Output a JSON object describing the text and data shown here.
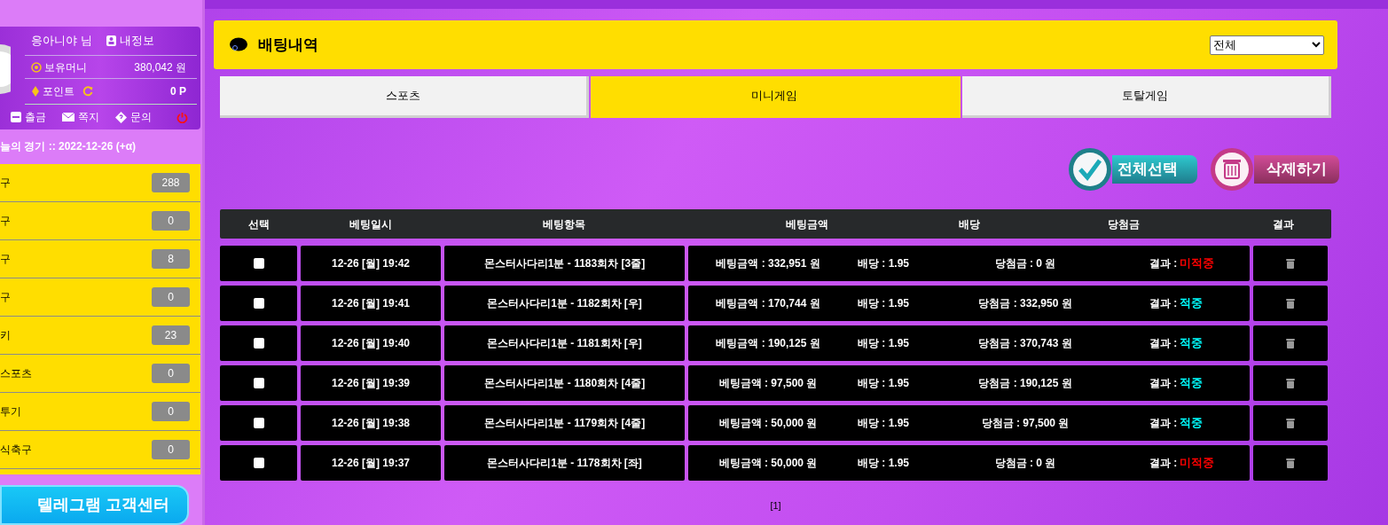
{
  "user": {
    "name": "응아니야 님",
    "my_info": "내정보",
    "money_label": "보유머니",
    "money": "380,042 원",
    "point_label": "포인트",
    "point": "0 P",
    "actions": [
      "출금",
      "쪽지",
      "문의"
    ]
  },
  "today": "늘의 경기 :: 2022-12-26 (+α)",
  "sports": [
    {
      "name": "구",
      "count": "288"
    },
    {
      "name": "구",
      "count": "0"
    },
    {
      "name": "구",
      "count": "8"
    },
    {
      "name": "구",
      "count": "0"
    },
    {
      "name": "키",
      "count": "23"
    },
    {
      "name": "스포츠",
      "count": "0"
    },
    {
      "name": "투기",
      "count": "0"
    },
    {
      "name": "식축구",
      "count": "0"
    }
  ],
  "telegram": "텔레그램 고객센터",
  "header": {
    "title": "배팅내역",
    "filter": "전체"
  },
  "tabs": [
    {
      "label": "스포츠",
      "selected": false
    },
    {
      "label": "미니게임",
      "selected": true
    },
    {
      "label": "토탈게임",
      "selected": false
    }
  ],
  "buttons": {
    "select_all": "전체선택",
    "delete": "삭제하기"
  },
  "columns": [
    "선택",
    "베팅일시",
    "베팅항목",
    "베팅금액",
    "배당",
    "당첨금",
    "결과"
  ],
  "rows": [
    {
      "checked": false,
      "date": "12-26 [월] 19:42",
      "item": "몬스터사다리1분 - 1183회차 [3줄]",
      "bet": "베팅금액 : 332,951 원",
      "odds": "배당 : 1.95",
      "win": "당첨금 : 0 원",
      "result_label": "결과 :",
      "result": "미적중",
      "color": "#ff0000"
    },
    {
      "checked": false,
      "date": "12-26 [월] 19:41",
      "item": "몬스터사다리1분 - 1182회차 [우]",
      "bet": "베팅금액 : 170,744 원",
      "odds": "배당 : 1.95",
      "win": "당첨금 : 332,950 원",
      "result_label": "결과 :",
      "result": "적중",
      "color": "#00ffff"
    },
    {
      "checked": false,
      "date": "12-26 [월] 19:40",
      "item": "몬스터사다리1분 - 1181회차 [우]",
      "bet": "베팅금액 : 190,125 원",
      "odds": "배당 : 1.95",
      "win": "당첨금 : 370,743 원",
      "result_label": "결과 :",
      "result": "적중",
      "color": "#00ffff"
    },
    {
      "checked": false,
      "date": "12-26 [월] 19:39",
      "item": "몬스터사다리1분 - 1180회차 [4줄]",
      "bet": "베팅금액 : 97,500 원",
      "odds": "배당 : 1.95",
      "win": "당첨금 : 190,125 원",
      "result_label": "결과 :",
      "result": "적중",
      "color": "#00ffff"
    },
    {
      "checked": false,
      "date": "12-26 [월] 19:38",
      "item": "몬스터사다리1분 - 1179회차 [4줄]",
      "bet": "베팅금액 : 50,000 원",
      "odds": "배당 : 1.95",
      "win": "당첨금 : 97,500 원",
      "result_label": "결과 :",
      "result": "적중",
      "color": "#00ffff"
    },
    {
      "checked": false,
      "date": "12-26 [월] 19:37",
      "item": "몬스터사다리1분 - 1178회차 [좌]",
      "bet": "베팅금액 : 50,000 원",
      "odds": "배당 : 1.95",
      "win": "당첨금 : 0 원",
      "result_label": "결과 :",
      "result": "미적중",
      "color": "#ff0000"
    }
  ],
  "pagination": "[1]"
}
